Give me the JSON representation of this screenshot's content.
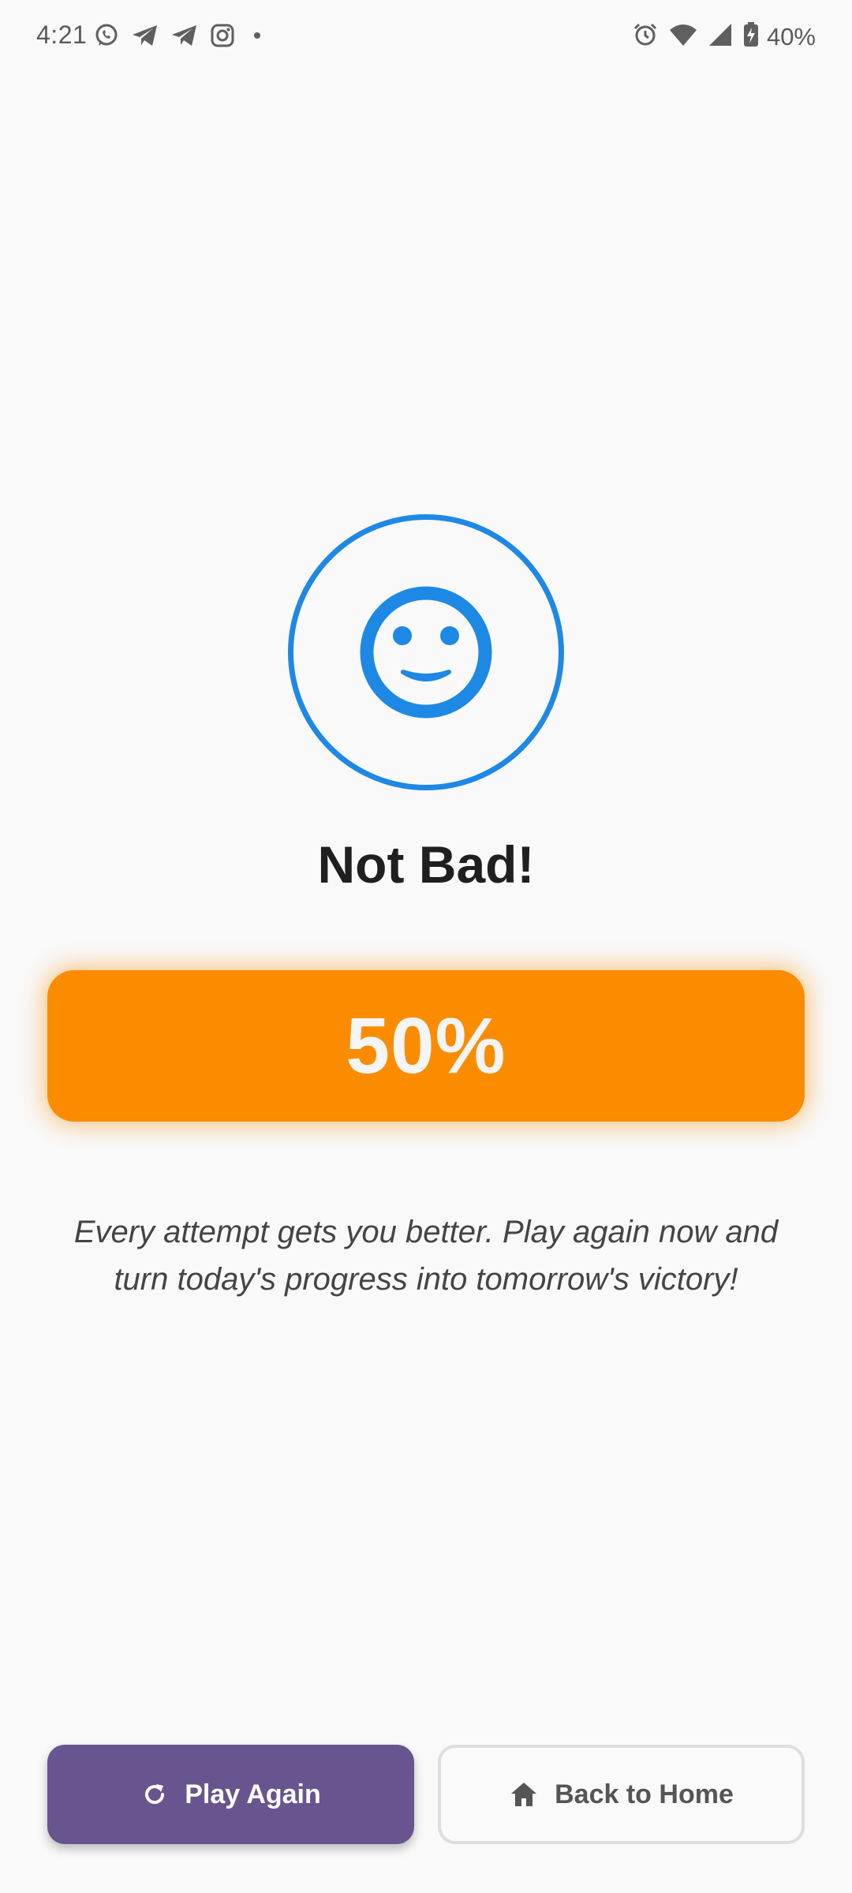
{
  "status_bar": {
    "time": "4:21",
    "left_icons": [
      "whatsapp-icon",
      "telegram-icon",
      "telegram-icon",
      "instagram-icon",
      "dot-icon"
    ],
    "right_icons": [
      "alarm-icon",
      "wifi-icon",
      "signal-icon",
      "battery-charging-icon"
    ],
    "battery_percent": "40%"
  },
  "result": {
    "emoji_icon": "smiley-face-icon",
    "title": "Not Bad!",
    "score": "50%",
    "message": "Every attempt gets you better. Play again now and turn today's progress into tomorrow's victory!"
  },
  "actions": {
    "play_again_label": "Play Again",
    "play_again_icon": "refresh-icon",
    "back_home_label": "Back to Home",
    "back_home_icon": "home-icon"
  },
  "colors": {
    "accent_blue": "#1e88e5",
    "score_orange": "#fb8c00",
    "primary_purple": "#68548e",
    "background": "#f9f9f9"
  }
}
